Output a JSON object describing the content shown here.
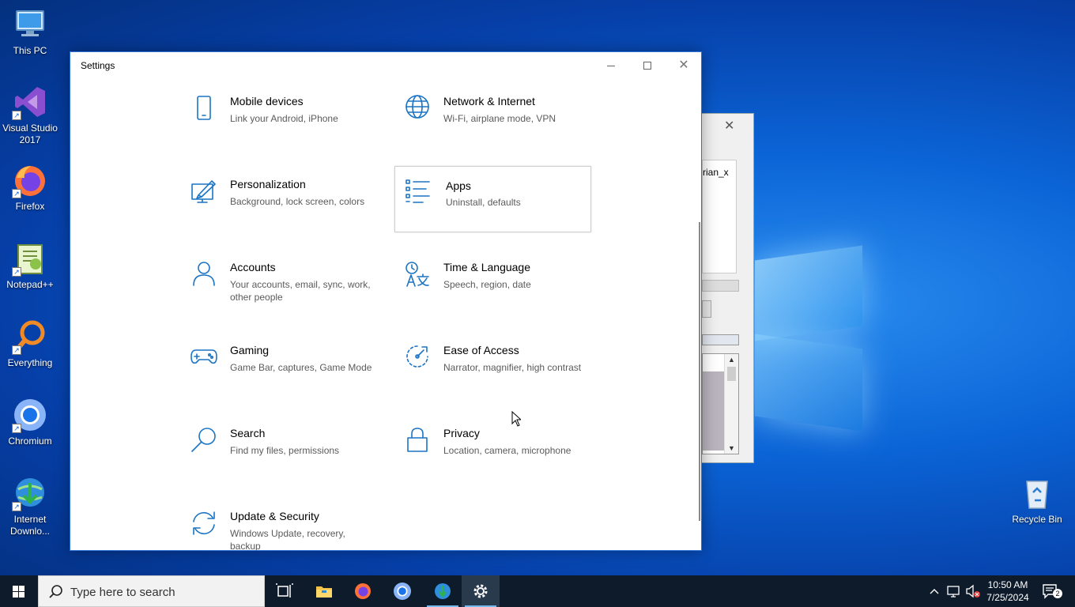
{
  "desktop": {
    "icons": [
      {
        "label": "This PC"
      },
      {
        "label": "Visual Studio 2017"
      },
      {
        "label": "Firefox"
      },
      {
        "label": "Notepad++"
      },
      {
        "label": "Everything"
      },
      {
        "label": "Chromium"
      },
      {
        "label": "Internet Downlo..."
      },
      {
        "label": "Recycle Bin"
      }
    ]
  },
  "background_dialog": {
    "field_text": "rian_x"
  },
  "settings_window": {
    "title": "Settings",
    "tiles": [
      {
        "name": "Mobile devices",
        "desc": "Link your Android, iPhone",
        "icon": "phone-icon"
      },
      {
        "name": "Network & Internet",
        "desc": "Wi-Fi, airplane mode, VPN",
        "icon": "globe-icon"
      },
      {
        "name": "Personalization",
        "desc": "Background, lock screen, colors",
        "icon": "paint-icon"
      },
      {
        "name": "Apps",
        "desc": "Uninstall, defaults",
        "icon": "apps-list-icon"
      },
      {
        "name": "Accounts",
        "desc": "Your accounts, email, sync, work, other people",
        "icon": "person-icon"
      },
      {
        "name": "Time & Language",
        "desc": "Speech, region, date",
        "icon": "time-language-icon"
      },
      {
        "name": "Gaming",
        "desc": "Game Bar, captures, Game Mode",
        "icon": "gamepad-icon"
      },
      {
        "name": "Ease of Access",
        "desc": "Narrator, magnifier, high contrast",
        "icon": "ease-of-access-icon"
      },
      {
        "name": "Search",
        "desc": "Find my files, permissions",
        "icon": "search-icon"
      },
      {
        "name": "Privacy",
        "desc": "Location, camera, microphone",
        "icon": "lock-icon"
      },
      {
        "name": "Update & Security",
        "desc": "Windows Update, recovery, backup",
        "icon": "sync-icon"
      }
    ]
  },
  "taskbar": {
    "search_placeholder": "Type here to search",
    "time": "10:50 AM",
    "date": "7/25/2024",
    "notification_count": "2"
  },
  "colors": {
    "accent": "#1b74c4",
    "taskbar": "#0e1b2b"
  }
}
